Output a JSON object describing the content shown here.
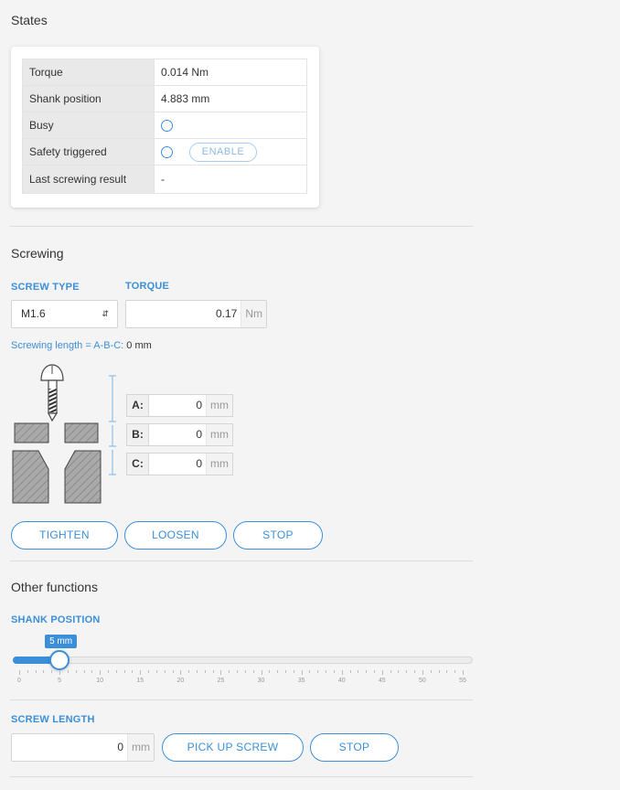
{
  "states": {
    "title": "States",
    "rows": [
      {
        "label": "Torque",
        "value": "0.014 Nm"
      },
      {
        "label": "Shank position",
        "value": "4.883 mm"
      },
      {
        "label": "Busy",
        "value": ""
      },
      {
        "label": "Safety triggered",
        "value": ""
      },
      {
        "label": "Last screwing result",
        "value": "-"
      }
    ],
    "enable_label": "ENABLE"
  },
  "screwing": {
    "title": "Screwing",
    "screw_type_label": "SCREW TYPE",
    "screw_type_value": "M1.6",
    "torque_label": "TORQUE",
    "torque_value": "0.17",
    "torque_unit": "Nm",
    "length_prefix": "Screwing length = A-B-C:",
    "length_value": "0 mm",
    "fields": [
      {
        "label": "A:",
        "value": "0",
        "unit": "mm"
      },
      {
        "label": "B:",
        "value": "0",
        "unit": "mm"
      },
      {
        "label": "C:",
        "value": "0",
        "unit": "mm"
      }
    ],
    "buttons": {
      "tighten": "TIGHTEN",
      "loosen": "LOOSEN",
      "stop": "STOP"
    }
  },
  "other": {
    "title": "Other functions",
    "shank_label": "SHANK POSITION",
    "shank_badge": "5 mm",
    "shank_value": 5,
    "shank_min": 0,
    "shank_max": 55,
    "tick_labels": [
      "0",
      "5",
      "10",
      "15",
      "20",
      "25",
      "30",
      "35",
      "40",
      "45",
      "50",
      "55"
    ],
    "screw_length_label": "SCREW LENGTH",
    "screw_length_value": "0",
    "screw_length_unit": "mm",
    "pick_up_label": "PICK UP SCREW",
    "stop_label": "STOP"
  },
  "colors": {
    "accent": "#3b8fd9"
  }
}
